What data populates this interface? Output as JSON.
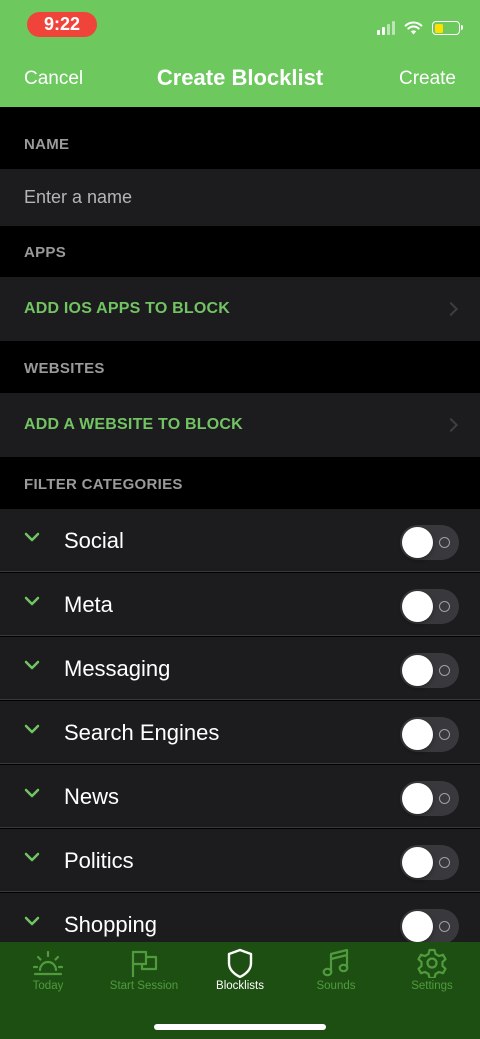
{
  "status_bar": {
    "time": "9:22"
  },
  "nav": {
    "cancel": "Cancel",
    "title": "Create Blocklist",
    "create": "Create"
  },
  "sections": {
    "name": {
      "label": "NAME",
      "placeholder": "Enter a name"
    },
    "apps": {
      "label": "APPS",
      "action": "ADD IOS APPS TO BLOCK"
    },
    "websites": {
      "label": "WEBSITES",
      "action": "ADD A WEBSITE TO BLOCK"
    },
    "filter": {
      "label": "FILTER CATEGORIES"
    }
  },
  "categories": [
    {
      "label": "Social",
      "enabled": false
    },
    {
      "label": "Meta",
      "enabled": false
    },
    {
      "label": "Messaging",
      "enabled": false
    },
    {
      "label": "Search Engines",
      "enabled": false
    },
    {
      "label": "News",
      "enabled": false
    },
    {
      "label": "Politics",
      "enabled": false
    },
    {
      "label": "Shopping",
      "enabled": false
    }
  ],
  "tabs": [
    {
      "label": "Today",
      "icon": "sun-horizon-icon",
      "active": false
    },
    {
      "label": "Start Session",
      "icon": "flag-icon",
      "active": false
    },
    {
      "label": "Blocklists",
      "icon": "shield-icon",
      "active": true
    },
    {
      "label": "Sounds",
      "icon": "music-note-icon",
      "active": false
    },
    {
      "label": "Settings",
      "icon": "gear-icon",
      "active": false
    }
  ],
  "colors": {
    "header_green": "#6dc85e",
    "accent_green": "#72c463",
    "tabbar_green": "#1e4f12",
    "cell_bg": "#1c1c1e",
    "background": "#000000"
  }
}
